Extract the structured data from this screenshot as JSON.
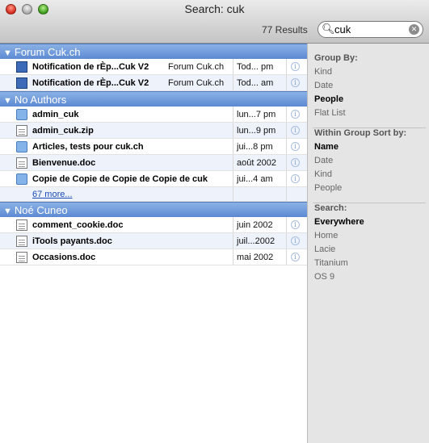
{
  "window": {
    "title": "Search: cuk"
  },
  "toolbar": {
    "results": "77 Results",
    "search_value": "cuk"
  },
  "groups": [
    {
      "label": "Forum Cuk.ch",
      "rows": [
        {
          "name": "Notification de rÈp...Cuk V2",
          "kind": "Forum Cuk.ch",
          "date": "Tod... pm",
          "icon": "mail-icon"
        },
        {
          "name": "Notification de rÈp...Cuk V2",
          "kind": "Forum Cuk.ch",
          "date": "Tod... am",
          "icon": "mail-icon"
        }
      ]
    },
    {
      "label": "No Authors",
      "rows": [
        {
          "name": "admin_cuk",
          "kind": "",
          "date": "lun...7 pm",
          "icon": "folder-icon"
        },
        {
          "name": "admin_cuk.zip",
          "kind": "",
          "date": "lun...9 pm",
          "icon": "document-icon"
        },
        {
          "name": "Articles, tests pour cuk.ch",
          "kind": "",
          "date": "jui...8 pm",
          "icon": "folder-icon"
        },
        {
          "name": "Bienvenue.doc",
          "kind": "",
          "date": "août 2002",
          "icon": "document-icon"
        },
        {
          "name": "Copie de Copie de Copie de Copie de cuk",
          "kind": "",
          "date": "jui...4 am",
          "icon": "folder-icon"
        }
      ],
      "more": "67 more..."
    },
    {
      "label": "Noé Cuneo",
      "rows": [
        {
          "name": "comment_cookie.doc",
          "kind": "",
          "date": "juin 2002",
          "icon": "document-icon"
        },
        {
          "name": "iTools payants.doc",
          "kind": "",
          "date": "juil...2002",
          "icon": "document-icon"
        },
        {
          "name": "Occasions.doc",
          "kind": "",
          "date": "mai 2002",
          "icon": "document-icon"
        }
      ]
    }
  ],
  "sidebar": {
    "group_by": {
      "heading": "Group By:",
      "options": [
        "Kind",
        "Date",
        "People",
        "Flat List"
      ],
      "selected": "People"
    },
    "sort": {
      "heading": "Within Group Sort by:",
      "options": [
        "Name",
        "Date",
        "Kind",
        "People"
      ],
      "selected": "Name"
    },
    "search": {
      "heading": "Search:",
      "options": [
        "Everywhere",
        "Home",
        "Lacie",
        "Titanium",
        "OS 9"
      ],
      "selected": "Everywhere"
    }
  }
}
